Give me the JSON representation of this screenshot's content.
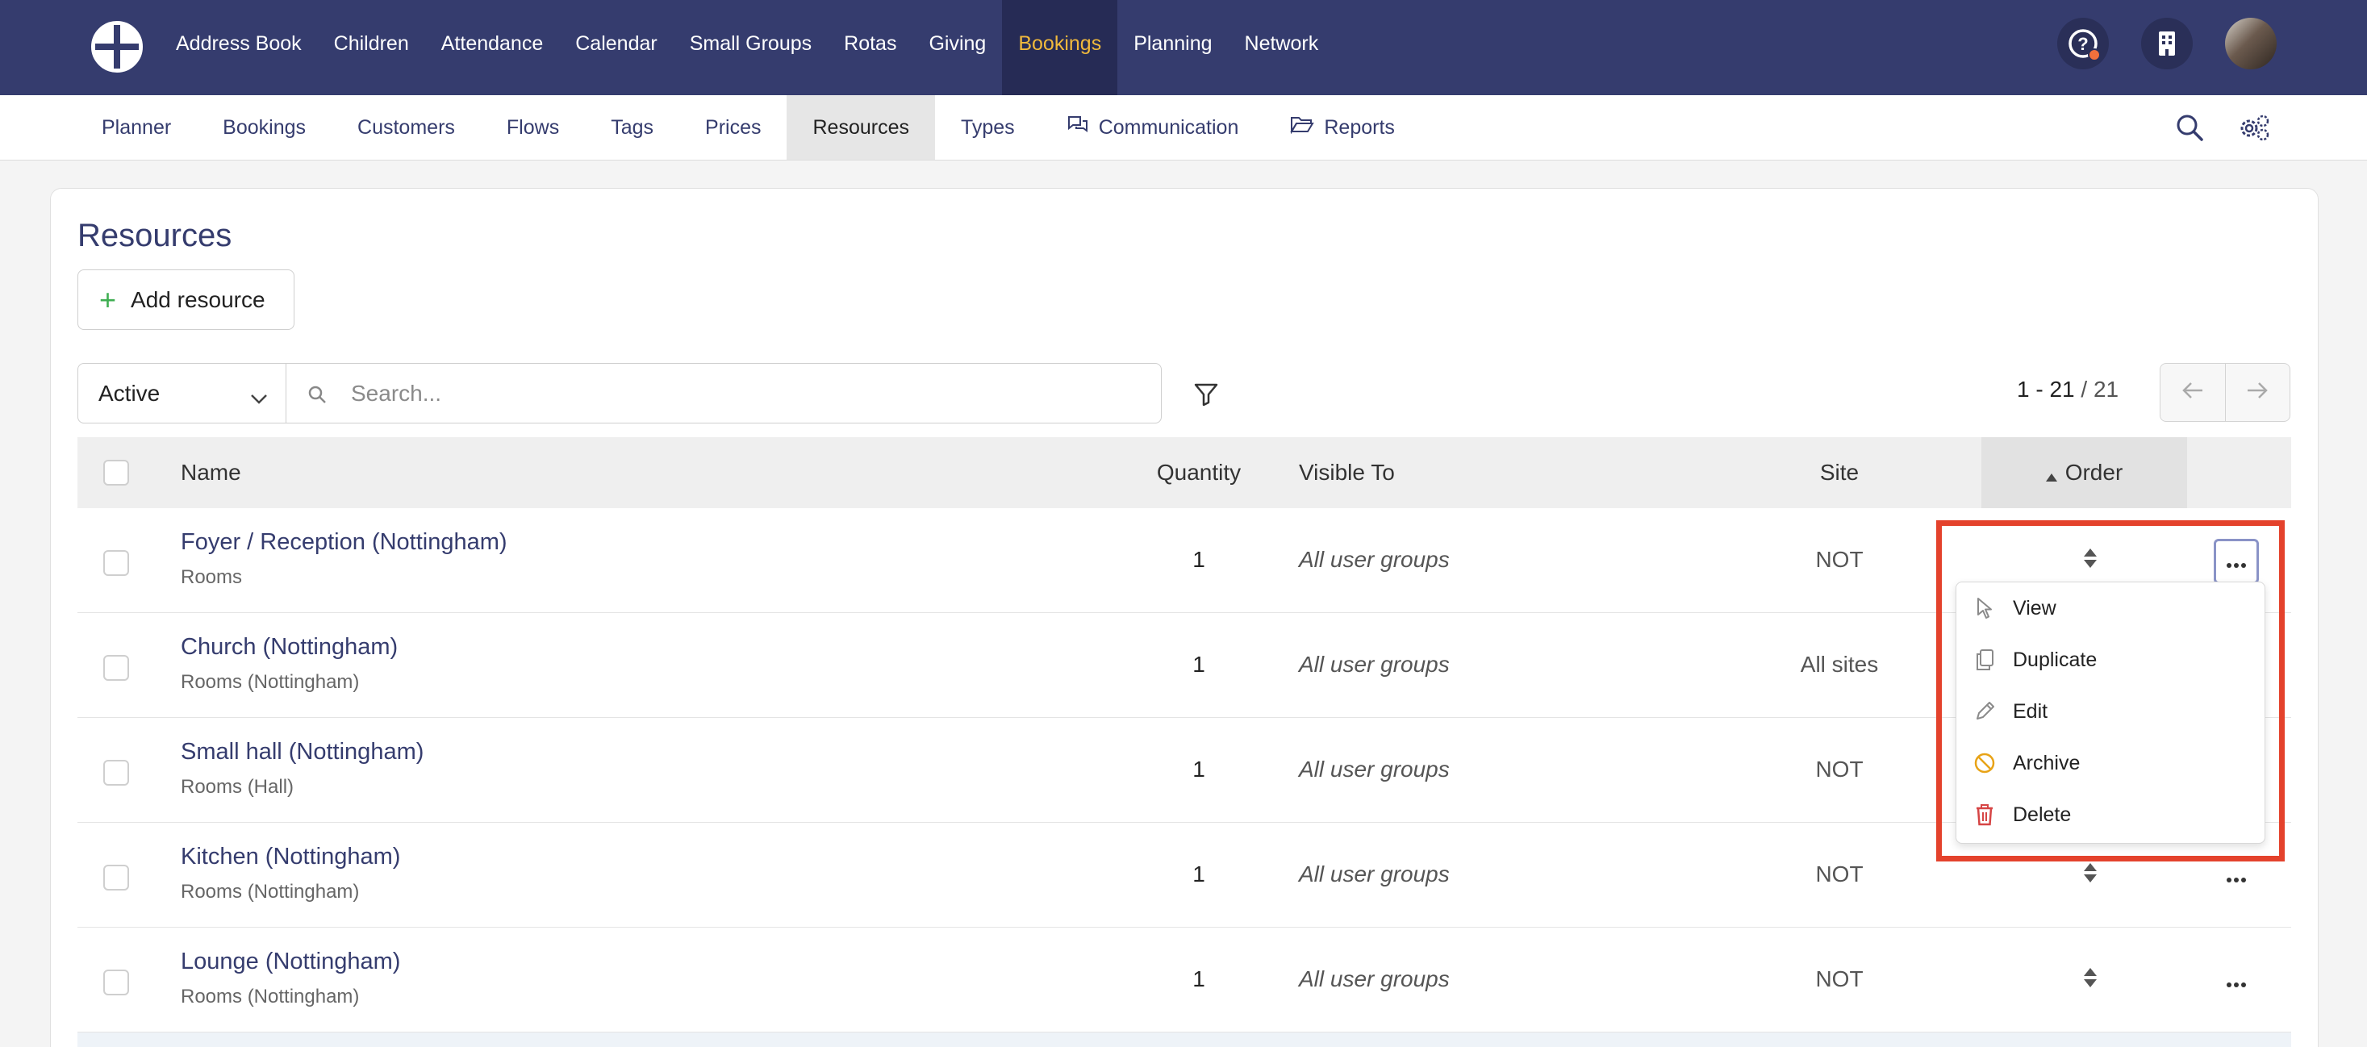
{
  "top_nav": {
    "items": [
      "Address Book",
      "Children",
      "Attendance",
      "Calendar",
      "Small Groups",
      "Rotas",
      "Giving",
      "Bookings",
      "Planning",
      "Network"
    ],
    "active": "Bookings",
    "icons": [
      "help-icon",
      "building-icon",
      "avatar"
    ]
  },
  "sub_nav": {
    "items": [
      "Planner",
      "Bookings",
      "Customers",
      "Flows",
      "Tags",
      "Prices",
      "Resources",
      "Types",
      "Communication",
      "Reports"
    ],
    "active": "Resources",
    "icons": [
      "search-icon",
      "settings-icon"
    ]
  },
  "page": {
    "title": "Resources",
    "add_button": "Add resource"
  },
  "filters": {
    "status": "Active",
    "search_placeholder": "Search..."
  },
  "pagination": {
    "range": "1 - 21",
    "total": "/ 21"
  },
  "table": {
    "columns": [
      "Name",
      "Quantity",
      "Visible To",
      "Site",
      "Order"
    ],
    "sort_column": "Order",
    "rows": [
      {
        "name": "Foyer / Reception (Nottingham)",
        "type": "Rooms",
        "quantity": "1",
        "visible_to": "All user groups",
        "site": "NOT"
      },
      {
        "name": "Church (Nottingham)",
        "type": "Rooms (Nottingham)",
        "quantity": "1",
        "visible_to": "All user groups",
        "site": "All sites"
      },
      {
        "name": "Small hall (Nottingham)",
        "type": "Rooms (Hall)",
        "quantity": "1",
        "visible_to": "All user groups",
        "site": "NOT"
      },
      {
        "name": "Kitchen (Nottingham)",
        "type": "Rooms (Nottingham)",
        "quantity": "1",
        "visible_to": "All user groups",
        "site": "NOT"
      },
      {
        "name": "Lounge (Nottingham)",
        "type": "Rooms (Nottingham)",
        "quantity": "1",
        "visible_to": "All user groups",
        "site": "NOT"
      }
    ]
  },
  "row_menu": {
    "items": [
      {
        "label": "View",
        "icon": "pointer-icon",
        "color": "#8a8a8a"
      },
      {
        "label": "Duplicate",
        "icon": "copy-icon",
        "color": "#8a8a8a"
      },
      {
        "label": "Edit",
        "icon": "pencil-icon",
        "color": "#8a8a8a"
      },
      {
        "label": "Archive",
        "icon": "archive-icon",
        "color": "#e8a317"
      },
      {
        "label": "Delete",
        "icon": "trash-icon",
        "color": "#d64545"
      }
    ]
  },
  "colors": {
    "nav_bg": "#353c6e",
    "active_nav": "#f0b93c",
    "link": "#353c6e",
    "highlight": "#e4422c"
  }
}
